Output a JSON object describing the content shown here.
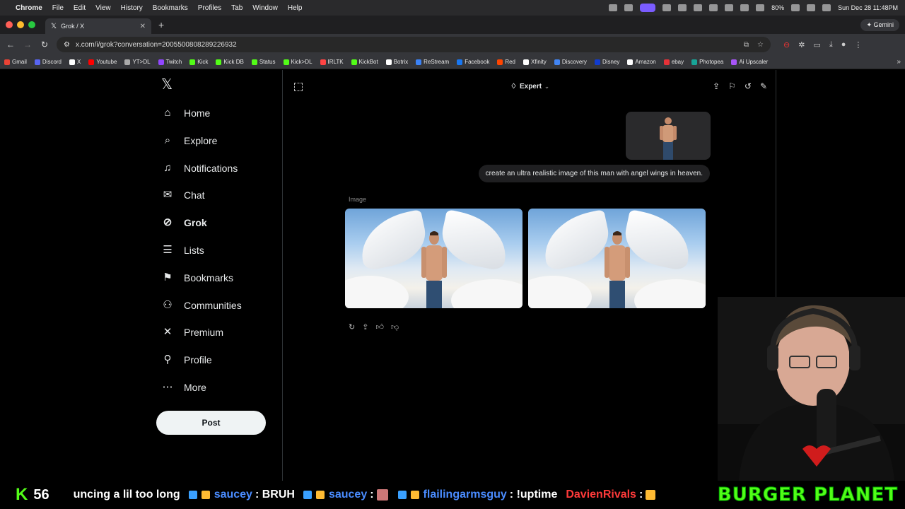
{
  "macos": {
    "app": "Chrome",
    "menus": [
      "File",
      "Edit",
      "View",
      "History",
      "Bookmarks",
      "Profiles",
      "Tab",
      "Window",
      "Help"
    ],
    "battery": "80%",
    "clock": "Sun Dec 28  11:48PM"
  },
  "browser": {
    "tab_title": "Grok / X",
    "url": "x.com/i/grok?conversation=2005500808289226932",
    "gemini_label": "Gemini"
  },
  "bookmarks": [
    {
      "label": "Gmail",
      "color": "#ea4335"
    },
    {
      "label": "Discord",
      "color": "#5865f2"
    },
    {
      "label": "X",
      "color": "#ffffff"
    },
    {
      "label": "Youtube",
      "color": "#ff0000"
    },
    {
      "label": "YT>DL",
      "color": "#aaaaaa"
    },
    {
      "label": "Twitch",
      "color": "#9146ff"
    },
    {
      "label": "Kick",
      "color": "#53fc18"
    },
    {
      "label": "Kick DB",
      "color": "#53fc18"
    },
    {
      "label": "Status",
      "color": "#53fc18"
    },
    {
      "label": "Kick>DL",
      "color": "#53fc18"
    },
    {
      "label": "IRLTK",
      "color": "#ff4444"
    },
    {
      "label": "KickBot",
      "color": "#53fc18"
    },
    {
      "label": "Botrix",
      "color": "#ffffff"
    },
    {
      "label": "ReStream",
      "color": "#3b82f6"
    },
    {
      "label": "Facebook",
      "color": "#1877f2"
    },
    {
      "label": "Red",
      "color": "#ff4500"
    },
    {
      "label": "Xfinity",
      "color": "#ffffff"
    },
    {
      "label": "Discovery",
      "color": "#4285f4"
    },
    {
      "label": "Disney",
      "color": "#113ccf"
    },
    {
      "label": "Amazon",
      "color": "#ffffff"
    },
    {
      "label": "ebay",
      "color": "#e53238"
    },
    {
      "label": "Photopea",
      "color": "#18a497"
    },
    {
      "label": "Ai Upscaler",
      "color": "#a855f7"
    }
  ],
  "sidebar": {
    "items": [
      {
        "label": "Home",
        "icon": "home-icon",
        "glyph": "⌂"
      },
      {
        "label": "Explore",
        "icon": "search-icon",
        "glyph": "⌕"
      },
      {
        "label": "Notifications",
        "icon": "bell-icon",
        "glyph": "♫"
      },
      {
        "label": "Chat",
        "icon": "mail-icon",
        "glyph": "✉"
      },
      {
        "label": "Grok",
        "icon": "grok-icon",
        "glyph": "⊘"
      },
      {
        "label": "Lists",
        "icon": "list-icon",
        "glyph": "☰"
      },
      {
        "label": "Bookmarks",
        "icon": "bookmark-icon",
        "glyph": "⚑"
      },
      {
        "label": "Communities",
        "icon": "people-icon",
        "glyph": "⚇"
      },
      {
        "label": "Premium",
        "icon": "x-premium-icon",
        "glyph": "✕"
      },
      {
        "label": "Profile",
        "icon": "person-icon",
        "glyph": "⚲"
      },
      {
        "label": "More",
        "icon": "more-icon",
        "glyph": "⋯"
      }
    ],
    "post_label": "Post"
  },
  "grok": {
    "mode_label": "Expert",
    "user_message": "create an ultra realistic image of this man with angel wings in heaven.",
    "image_label": "Image"
  },
  "stream": {
    "viewer_count": "56",
    "ticker": [
      {
        "user": "",
        "text": "uncing a lil too long"
      },
      {
        "user": "saucey",
        "text": ": BRUH"
      },
      {
        "user": "saucey",
        "text": ":"
      },
      {
        "user": "flailingarmsguy",
        "text": ": !uptime"
      },
      {
        "user": "DavienRivals",
        "text": ":"
      }
    ],
    "banner": "BURGER PLANET"
  }
}
